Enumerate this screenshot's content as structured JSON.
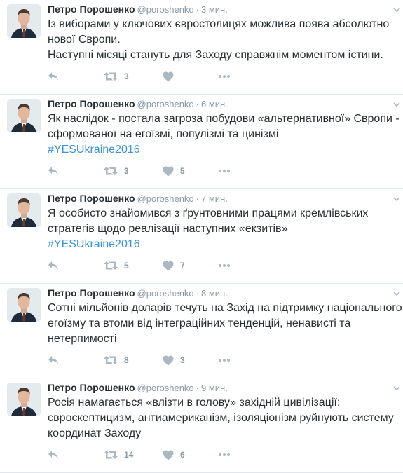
{
  "tweets": [
    {
      "author": "Петро Порошенко",
      "handle": "@poroshenko",
      "separator": "·",
      "time": "3 мин.",
      "lines": [
        "Із виборами у ключових євростолицях можлива поява абсолютно",
        "нової Європи.",
        "Наступні місяці стануть для Заходу справжнім моментом істини."
      ],
      "hashtag": "",
      "retweets": "3",
      "likes": ""
    },
    {
      "author": "Петро Порошенко",
      "handle": "@poroshenko",
      "separator": "·",
      "time": "6 мин.",
      "lines": [
        "Як наслідок - постала загроза побудови «альтернативної» Європи -",
        "сформованої на егоїзмі, популізмі та цинізмі"
      ],
      "hashtag": "#YESUkraine2016",
      "retweets": "3",
      "likes": "5"
    },
    {
      "author": "Петро Порошенко",
      "handle": "@poroshenko",
      "separator": "·",
      "time": "7 мин.",
      "lines": [
        "Я особисто знайомився з ґрунтовними працями кремлівських",
        "стратегів щодо реалізації наступних «екзитів»"
      ],
      "hashtag": "#YESUkraine2016",
      "retweets": "5",
      "likes": "7"
    },
    {
      "author": "Петро Порошенко",
      "handle": "@poroshenko",
      "separator": "·",
      "time": "8 мин.",
      "lines": [
        "Сотні мільйонів доларів течуть на Захід на підтримку національного",
        "егоїзму та втоми від інтеграційних тенденцій, ненависті та",
        "нетерпимості"
      ],
      "hashtag": "",
      "retweets": "8",
      "likes": "3"
    },
    {
      "author": "Петро Порошенко",
      "handle": "@poroshenko",
      "separator": "·",
      "time": "9 мин.",
      "lines": [
        "Росія намагається «влізти в голову» західній цивілізації:",
        "євроскептицизм, антиамериканізм, ізоляціонізм руйнують систему",
        "координат Заходу"
      ],
      "hashtag": "",
      "retweets": "14",
      "likes": "6"
    }
  ],
  "icons": {
    "reply": "reply-icon",
    "retweet": "retweet-icon",
    "like": "heart-icon",
    "more": "more-icon",
    "caret": "chevron-down-icon"
  },
  "colors": {
    "text": "#292f33",
    "meta": "#8899a6",
    "icon": "#aab8c2",
    "hashtag": "#3b94d9",
    "divider": "#e1e8ed"
  }
}
